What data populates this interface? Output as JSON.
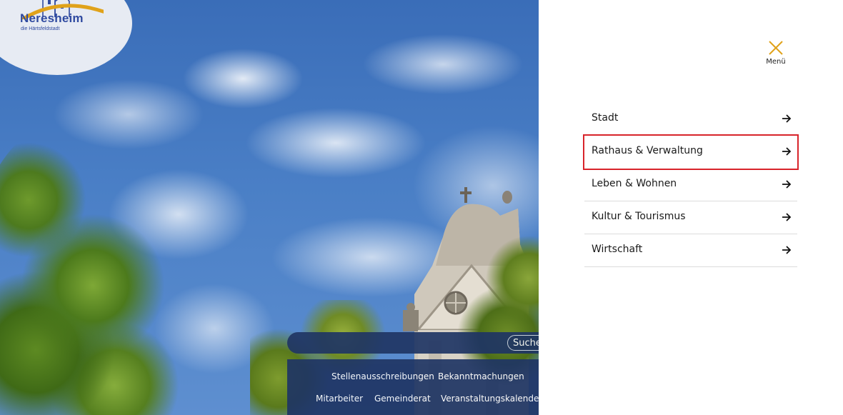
{
  "logo": {
    "name": "Neresheim",
    "subtitle": "die Härtsfeldstadt",
    "colors": {
      "text": "#2f4aa0",
      "arc": "#e0a21a"
    }
  },
  "search": {
    "placeholder": "",
    "button_label": "Suche"
  },
  "quick_links": [
    {
      "label": "Stellenausschreibungen"
    },
    {
      "label": "Bekanntmachungen"
    },
    {
      "label": "Mitarbeiter"
    },
    {
      "label": "Gemeinderat"
    },
    {
      "label": "Veranstaltungskalender"
    }
  ],
  "menu": {
    "label": "Menü",
    "close_icon": "close-icon",
    "accent_color": "#e0a21a",
    "items": [
      {
        "label": "Stadt",
        "icon": "arrow-right-icon"
      },
      {
        "label": "Rathaus & Verwaltung",
        "icon": "arrow-right-icon",
        "highlighted": true
      },
      {
        "label": "Leben & Wohnen",
        "icon": "arrow-right-icon"
      },
      {
        "label": "Kultur & Tourismus",
        "icon": "arrow-right-icon"
      },
      {
        "label": "Wirtschaft",
        "icon": "arrow-right-icon"
      }
    ]
  }
}
